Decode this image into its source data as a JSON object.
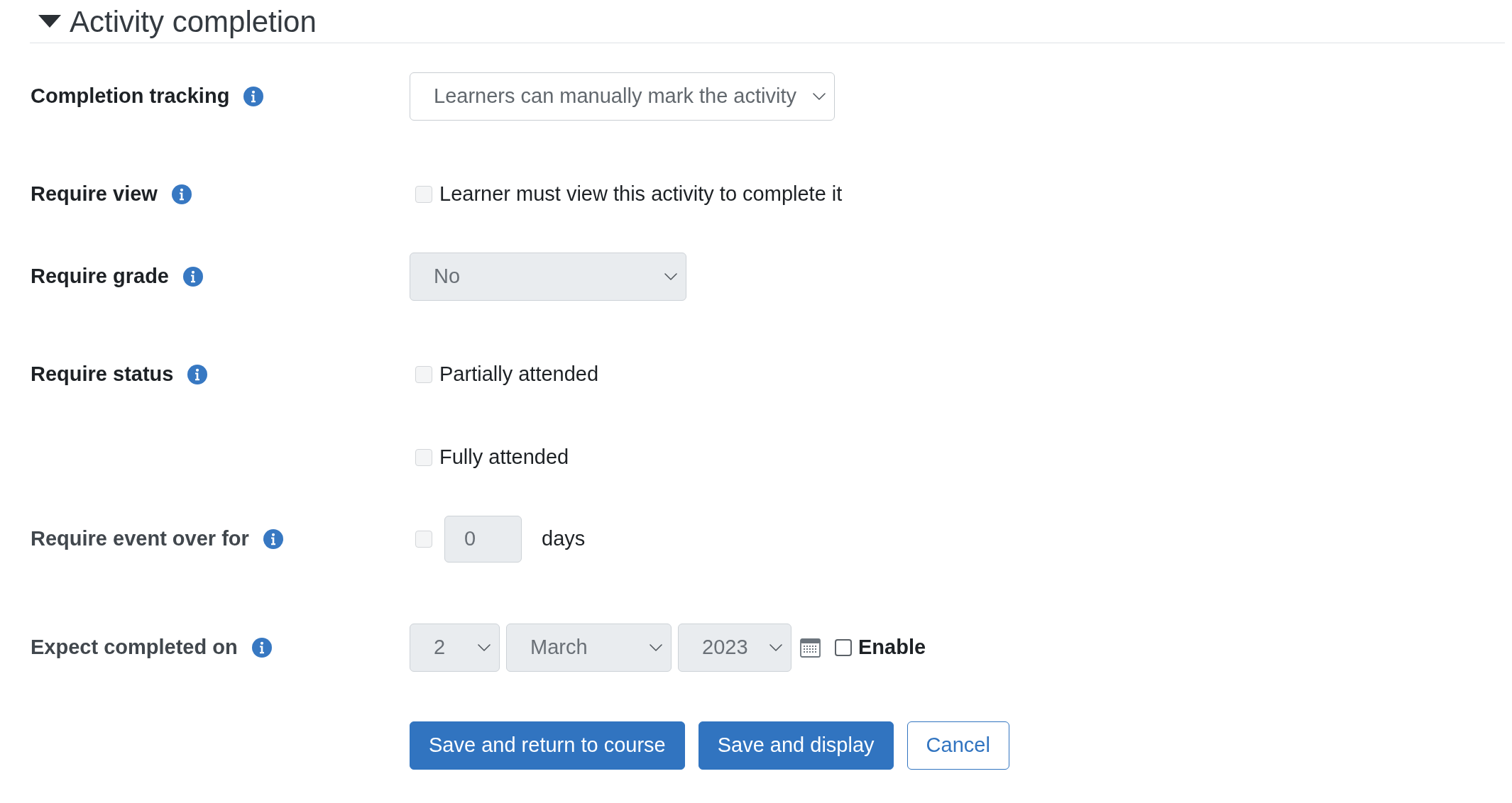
{
  "section": {
    "title": "Activity completion",
    "expanded": true
  },
  "rows": [
    {
      "kind": "select",
      "label": "Completion tracking",
      "dimmed": false,
      "select": {
        "value": "Learners can manually mark the activity",
        "disabled": false
      }
    },
    {
      "kind": "checkbox",
      "label": "Require view",
      "dimmed": false,
      "options": [
        {
          "text": "Learner must view this activity to complete it",
          "checked": false,
          "disabled": true
        }
      ]
    },
    {
      "kind": "select",
      "label": "Require grade",
      "dimmed": false,
      "select": {
        "value": "No",
        "disabled": true
      }
    },
    {
      "kind": "checkbox",
      "label": "Require status",
      "dimmed": false,
      "options": [
        {
          "text": "Partially attended",
          "checked": false,
          "disabled": true
        },
        {
          "text": "Fully attended",
          "checked": false,
          "disabled": true
        }
      ]
    },
    {
      "kind": "number",
      "label": "Require event over for",
      "dimmed": true,
      "checkbox": {
        "checked": false,
        "disabled": true
      },
      "input": {
        "value": "0",
        "disabled": true
      },
      "unit": "days"
    },
    {
      "kind": "date",
      "label": "Expect completed on",
      "dimmed": true,
      "selects": [
        {
          "value": "2",
          "disabled": true
        },
        {
          "value": "March",
          "disabled": true
        },
        {
          "value": "2023",
          "disabled": true
        }
      ],
      "enable": {
        "text": "Enable",
        "checked": false,
        "disabled": false
      }
    }
  ],
  "buttons": [
    {
      "label": "Save and return to course",
      "kind": "primary"
    },
    {
      "label": "Save and display",
      "kind": "primary"
    },
    {
      "label": "Cancel",
      "kind": "secondary"
    }
  ]
}
